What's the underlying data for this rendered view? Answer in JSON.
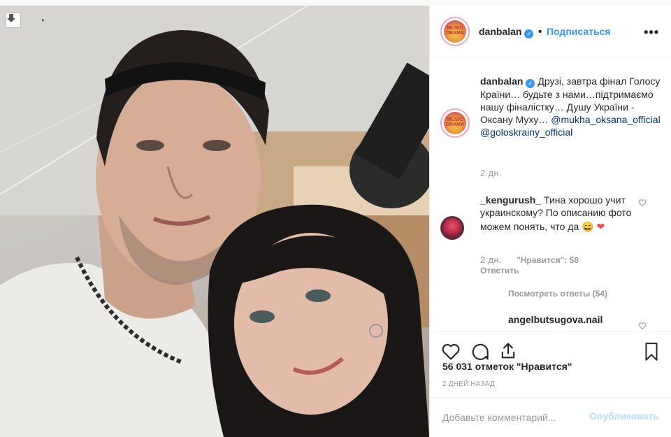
{
  "post": {
    "username": "danbalan",
    "verified_mark": "✓",
    "follow_label": "Подписаться",
    "more_icon": "more-horizontal-icon",
    "avatar_text": "MUSIC DRAMA"
  },
  "caption": {
    "username": "danbalan",
    "text": "Друзі, завтра фінал Голосу Країни… будьте з нами…підтримаємо нашу фіналістку… Душу України - Оксану Муху…",
    "mention1": "@mukha_oksana_official",
    "mention2": "@goloskrainy_official",
    "time": "2 дн."
  },
  "comments": [
    {
      "username": "_kengurush_",
      "text": "Тина хорошо учит украинскому? По описанию фото можем понять, что да",
      "emoji": "😄",
      "heart": "❤",
      "time": "2 дн.",
      "likes": "\"Нравится\": 58",
      "reply_label": "Ответить",
      "view_replies": "Посмотреть ответы (54)"
    },
    {
      "username": "angelbutsugova.nail"
    }
  ],
  "footer": {
    "likes": "56 031 отметок \"Нравится\"",
    "date": "2 ДНЕЙ НАЗАД",
    "comment_placeholder": "Добавьте комментарий...",
    "publish_label": "Опубликовать"
  },
  "colors": {
    "accent": "#3897f0",
    "heart": "#ed4956",
    "muted": "#999999",
    "publish_disabled": "#b2dffc"
  }
}
